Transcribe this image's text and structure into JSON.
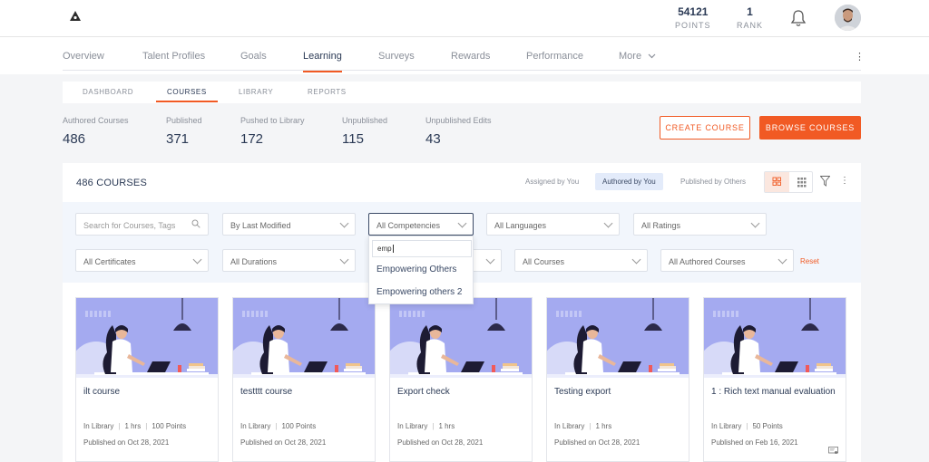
{
  "header": {
    "points_value": "54121",
    "points_label": "POINTS",
    "rank_value": "1",
    "rank_label": "RANK"
  },
  "nav": {
    "items": [
      "Overview",
      "Talent Profiles",
      "Goals",
      "Learning",
      "Surveys",
      "Rewards",
      "Performance",
      "More"
    ],
    "active": "Learning"
  },
  "subnav": {
    "items": [
      "DASHBOARD",
      "COURSES",
      "LIBRARY",
      "REPORTS"
    ],
    "active": "COURSES"
  },
  "stats": [
    {
      "label": "Authored Courses",
      "value": "486"
    },
    {
      "label": "Published",
      "value": "371"
    },
    {
      "label": "Pushed to Library",
      "value": "172"
    },
    {
      "label": "Unpublished",
      "value": "115"
    },
    {
      "label": "Unpublished Edits",
      "value": "43"
    }
  ],
  "actions": {
    "create_label": "CREATE COURSE",
    "browse_label": "BROWSE COURSES"
  },
  "panel": {
    "title": "486 COURSES",
    "segments": [
      "Assigned by You",
      "Authored by You",
      "Published by Others"
    ],
    "active_segment": "Authored by You"
  },
  "filters": {
    "search_placeholder": "Search for Courses, Tags",
    "sort": "By Last Modified",
    "competencies": "All Competencies",
    "languages": "All Languages",
    "ratings": "All Ratings",
    "certificates": "All Certificates",
    "durations": "All Durations",
    "courses": "All Courses",
    "authored": "All Authored Courses",
    "reset_label": "Reset"
  },
  "competency_dropdown": {
    "query": "emp",
    "options": [
      "Empowering Others",
      "Empowering others 2"
    ]
  },
  "cards": [
    {
      "title": "ilt course",
      "status": "In Library",
      "duration": "1 hrs",
      "points": "100 Points",
      "published": "Published on Oct 28, 2021"
    },
    {
      "title": "testttt course",
      "status": "In Library",
      "points": "100 Points",
      "published": "Published on Oct 28, 2021"
    },
    {
      "title": "Export check",
      "status": "In Library",
      "duration": "1 hrs",
      "published": "Published on Oct 28, 2021"
    },
    {
      "title": "Testing export",
      "status": "In Library",
      "duration": "1 hrs",
      "published": "Published on Oct 28, 2021"
    },
    {
      "title": "1 : Rich text manual evaluation",
      "status": "In Library",
      "points": "50 Points",
      "published": "Published on Feb 16, 2021"
    }
  ],
  "colors": {
    "accent": "#f15a24",
    "navy": "#2b3a55",
    "thumb_bg": "#a4aaf0"
  }
}
